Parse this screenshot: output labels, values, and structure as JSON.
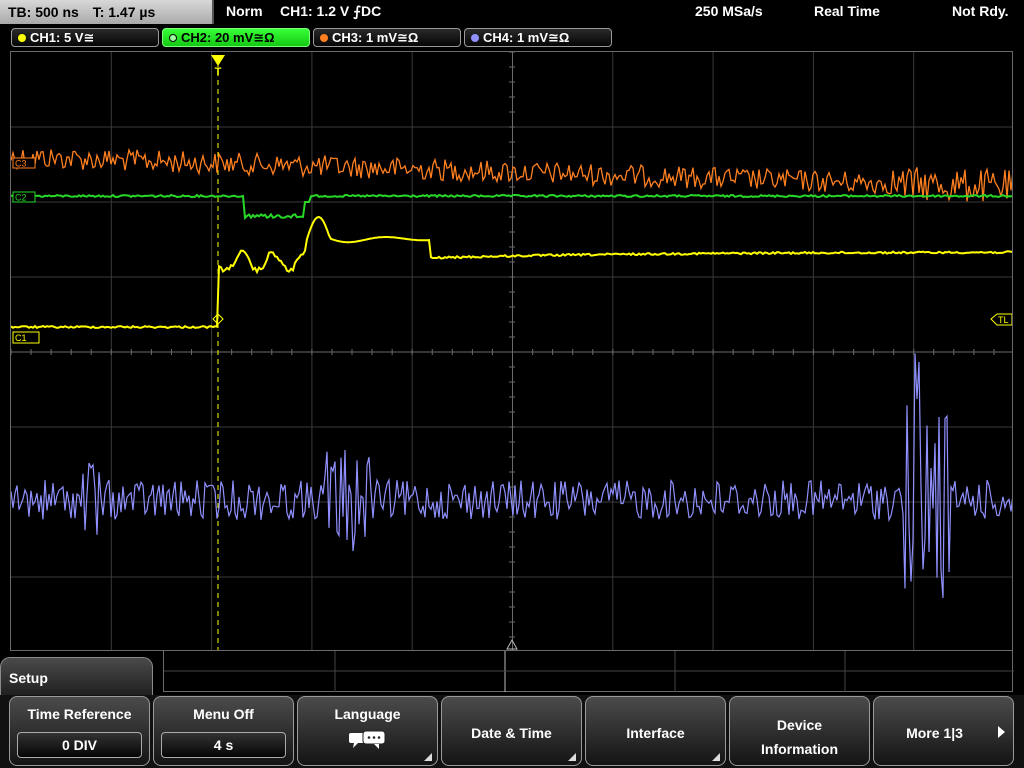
{
  "statusbar": {
    "timebase": "TB: 500 ns",
    "trigger_time": "T: 1.47 µs",
    "mode": "Norm",
    "trigger_info": "CH1: 1.2 V ⨍DC",
    "sample_rate": "250 MSa/s",
    "acq_mode": "Real Time",
    "state": "Not Rdy."
  },
  "channels": [
    {
      "label": "CH1: 5 V≅",
      "color": "#ffff00",
      "active": false
    },
    {
      "label": "CH2: 20 mV≅Ω",
      "color": "#28d828",
      "active": true
    },
    {
      "label": "CH3: 1 mV≅Ω",
      "color": "#ff8020",
      "active": false
    },
    {
      "label": "CH4: 1 mV≅Ω",
      "color": "#9090ff",
      "active": false
    }
  ],
  "markers": {
    "c1": "C1",
    "c2": "C2",
    "c3": "C3",
    "trigger_level": "TL",
    "trigger_pos": "T"
  },
  "menu": {
    "title": "Setup",
    "time_reference": {
      "label": "Time Reference",
      "value": "0 DIV"
    },
    "menu_off": {
      "label": "Menu Off",
      "value": "4 s"
    },
    "language": {
      "label": "Language",
      "icon": "speech-bubble-icon"
    },
    "date_time": {
      "label": "Date & Time"
    },
    "interface": {
      "label": "Interface"
    },
    "device_information": {
      "line1": "Device",
      "line2": "Information"
    },
    "more": {
      "label": "More 1|3"
    }
  },
  "colors": {
    "ch1": "#ffff00",
    "ch2": "#28d828",
    "ch3": "#ff8020",
    "ch4": "#9090ff",
    "grid": "#505050"
  }
}
